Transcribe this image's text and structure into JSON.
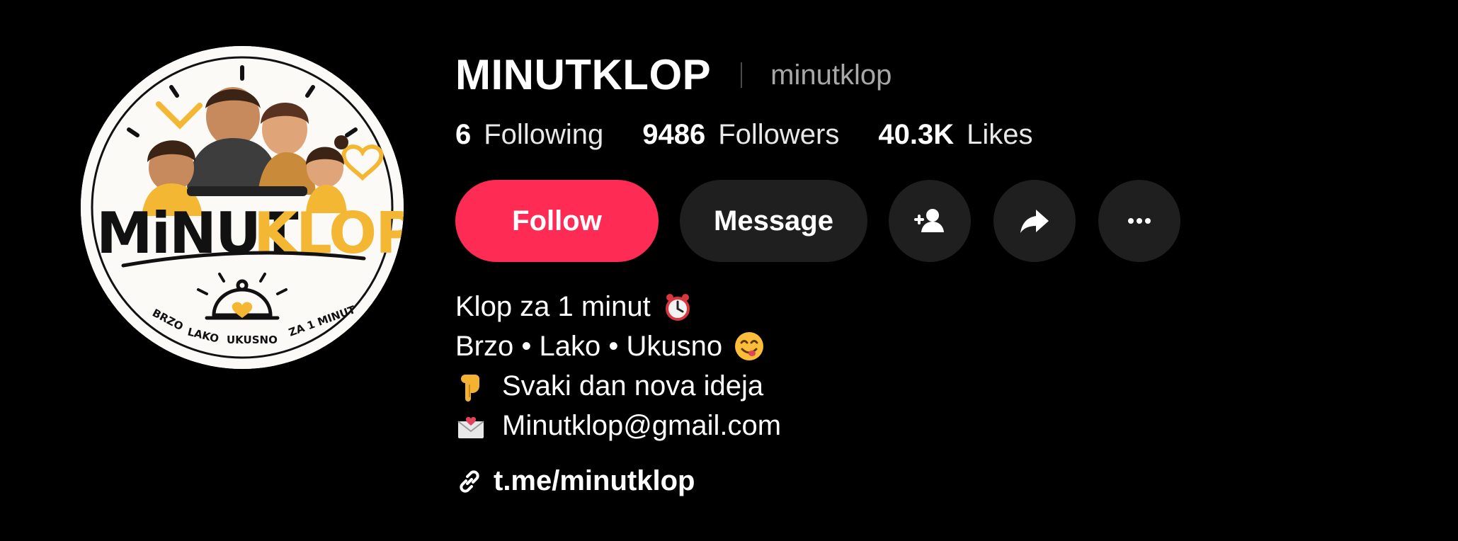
{
  "profile": {
    "display_name": "MINUTKLOP",
    "username": "minutklop",
    "avatar": {
      "logo_text_part1": "MiNUT",
      "logo_text_part2": "KLOP",
      "ring_text": [
        "BRZO",
        "LAKO",
        "UKUSNO",
        "ZA 1 MINUT"
      ]
    }
  },
  "stats": {
    "following_count": "6",
    "following_label": "Following",
    "followers_count": "9486",
    "followers_label": "Followers",
    "likes_count": "40.3K",
    "likes_label": "Likes"
  },
  "actions": {
    "follow_label": "Follow",
    "message_label": "Message",
    "icons": [
      "add-friend-icon",
      "share-icon",
      "more-icon"
    ]
  },
  "bio": {
    "line1": "Klop za 1 minut",
    "line2": "Brzo • Lako • Ukusno",
    "line3": "Svaki dan nova ideja",
    "line4": "Minutklop@gmail.com"
  },
  "link": {
    "text": "t.me/minutklop"
  },
  "colors": {
    "background": "#000000",
    "follow_button": "#fe2c55",
    "secondary_button": "#1f1f1f",
    "username": "#a8a8a8",
    "logo_yellow": "#f4b733"
  }
}
